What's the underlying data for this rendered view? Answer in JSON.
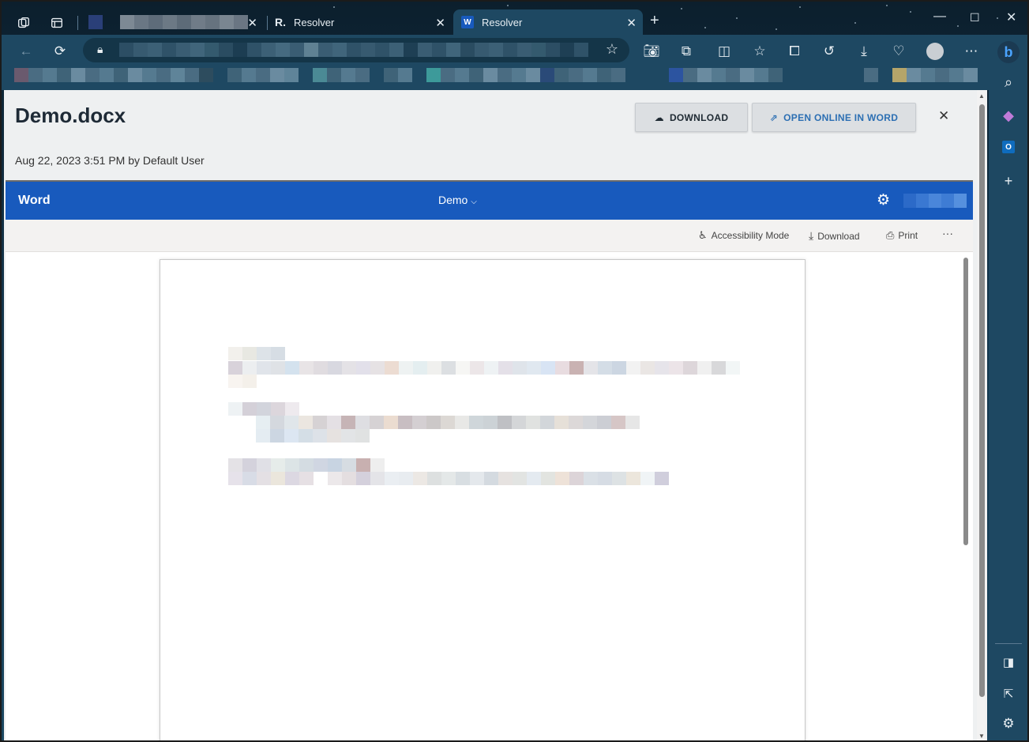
{
  "browser": {
    "tabs": [
      {
        "label": "",
        "favicon": "blurred-favicon",
        "active": false
      },
      {
        "label": "Resolver",
        "favicon": "resolver-r-logo",
        "active": false
      },
      {
        "label": "Resolver",
        "favicon": "word-icon",
        "active": true
      }
    ],
    "new_tab_glyph": "+",
    "window_controls": {
      "minimize": "—",
      "maximize": "☐",
      "close": "✕"
    },
    "address": {
      "url": ""
    }
  },
  "header": {
    "title": "Demo.docx",
    "meta": "Aug 22, 2023 3:51 PM by Default User",
    "download_label": "DOWNLOAD",
    "open_online_label": "OPEN ONLINE IN WORD",
    "close_glyph": "✕"
  },
  "word": {
    "brand": "Word",
    "doc_name": "Demo",
    "commands": {
      "accessibility": "Accessibility Mode",
      "download": "Download",
      "print": "Print",
      "more": "···"
    }
  },
  "colors": {
    "word_blue": "#185abd",
    "browser_chrome": "#1e4862",
    "link_blue": "#2c6fb3"
  }
}
